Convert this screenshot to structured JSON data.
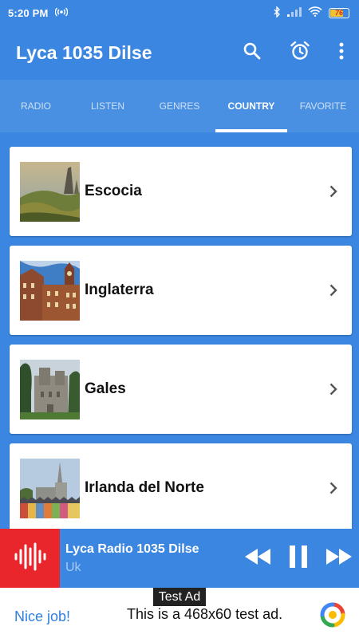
{
  "status": {
    "time": "5:20 PM",
    "battery": "76",
    "battery_level": 0.76,
    "icons": [
      "radio-waves-icon",
      "bluetooth-icon",
      "signal-icon",
      "wifi-icon",
      "battery-icon"
    ]
  },
  "app": {
    "title": "Lyca 1035 Dilse",
    "actions": [
      "search-icon",
      "alarm-clock-icon",
      "more-vertical-icon"
    ]
  },
  "tabs": [
    {
      "label": "RADIO",
      "active": false
    },
    {
      "label": "LISTEN",
      "active": false
    },
    {
      "label": "GENRES",
      "active": false
    },
    {
      "label": "COUNTRY",
      "active": true
    },
    {
      "label": "FAVORITE",
      "active": false
    }
  ],
  "countries": [
    {
      "name": "Escocia",
      "thumb": "highland-landscape"
    },
    {
      "name": "Inglaterra",
      "thumb": "brick-tower-building"
    },
    {
      "name": "Gales",
      "thumb": "stone-castle"
    },
    {
      "name": "Irlanda del Norte",
      "thumb": "cathedral-spire-town"
    }
  ],
  "player": {
    "title": "Lyca Radio 1035 Dilse",
    "subtitle": "Uk",
    "controls": [
      "rewind-icon",
      "pause-icon",
      "fast-forward-icon"
    ]
  },
  "ad": {
    "label": "Test Ad",
    "cta": "Nice job!",
    "text": "This is a 468x60 test ad."
  },
  "colors": {
    "primary": "#3b86e0",
    "tabs": "#4a90e2",
    "player_logo": "#e8262b",
    "ad_cta": "#2f7fe0"
  }
}
